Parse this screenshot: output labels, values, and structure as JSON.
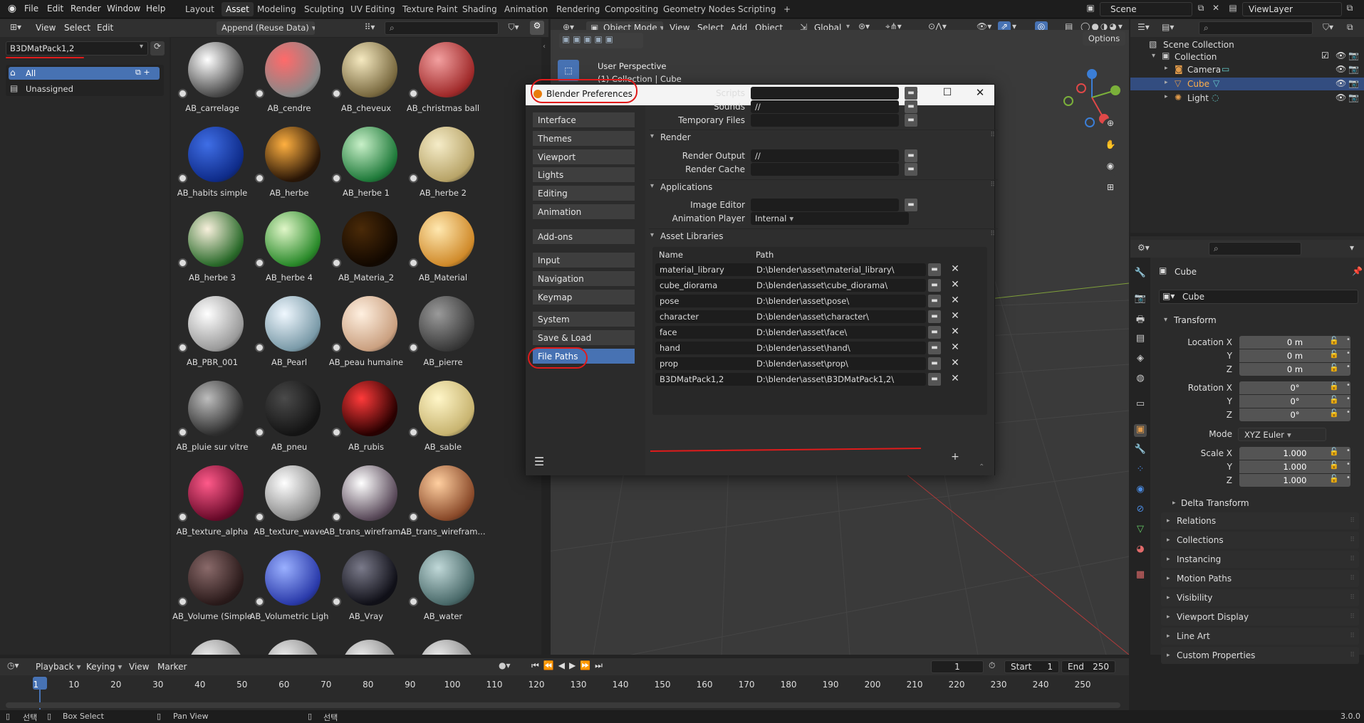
{
  "topbar": {
    "menus": [
      "File",
      "Edit",
      "Render",
      "Window",
      "Help"
    ],
    "workspaces": [
      "Layout",
      "Asset",
      "Modeling",
      "Sculpting",
      "UV Editing",
      "Texture Paint",
      "Shading",
      "Animation",
      "Rendering",
      "Compositing",
      "Geometry Nodes",
      "Scripting"
    ],
    "active_workspace": "Asset",
    "scene": "Scene",
    "viewlayer": "ViewLayer",
    "add_tab": "+"
  },
  "asset_browser": {
    "menus": [
      "View",
      "Select",
      "Edit"
    ],
    "import_method": "Append (Reuse Data)",
    "library": "B3DMatPack1,2",
    "catalogs": [
      "All",
      "Unassigned"
    ],
    "assets": [
      {
        "name": "AB_carrelage",
        "c1": "#ffffff",
        "c2": "#4a4a4a"
      },
      {
        "name": "AB_cendre",
        "c1": "#ff6a6a",
        "c2": "#888888"
      },
      {
        "name": "AB_cheveux",
        "c1": "#f5e9c0",
        "c2": "#7a6a40"
      },
      {
        "name": "AB_christmas ball",
        "c1": "#f2a0a0",
        "c2": "#a02a2a"
      },
      {
        "name": "AB_habits simple",
        "c1": "#3f6ee6",
        "c2": "#0f2c8a"
      },
      {
        "name": "AB_herbe",
        "c1": "#ffb040",
        "c2": "#2a1606"
      },
      {
        "name": "AB_herbe 1",
        "c1": "#c8f0c8",
        "c2": "#1f7a3a"
      },
      {
        "name": "AB_herbe 2",
        "c1": "#f5ecc8",
        "c2": "#b8a468"
      },
      {
        "name": "AB_herbe 3",
        "c1": "#f8f0dc",
        "c2": "#2a6a2a"
      },
      {
        "name": "AB_herbe 4",
        "c1": "#e0f6c8",
        "c2": "#2a8a2a"
      },
      {
        "name": "AB_Materia_2",
        "c1": "#4a2a08",
        "c2": "#120800"
      },
      {
        "name": "AB_Material",
        "c1": "#ffe8b0",
        "c2": "#d08a2a"
      },
      {
        "name": "AB_PBR_001",
        "c1": "#ffffff",
        "c2": "#9a9a9a"
      },
      {
        "name": "AB_Pearl",
        "c1": "#f0f8ff",
        "c2": "#7a9aa8"
      },
      {
        "name": "AB_peau humaine",
        "c1": "#fff0e0",
        "c2": "#caa080"
      },
      {
        "name": "AB_pierre",
        "c1": "#9a9a9a",
        "c2": "#3a3a3a"
      },
      {
        "name": "AB_pluie sur vitre",
        "c1": "#bdbdbd",
        "c2": "#2e2e2e"
      },
      {
        "name": "AB_pneu",
        "c1": "#4a4a4a",
        "c2": "#141414"
      },
      {
        "name": "AB_rubis",
        "c1": "#ff3a3a",
        "c2": "#2a0000"
      },
      {
        "name": "AB_sable",
        "c1": "#fff6c8",
        "c2": "#c8b470"
      },
      {
        "name": "AB_texture_alpha",
        "c1": "#ff5a8a",
        "c2": "#6a0a2a"
      },
      {
        "name": "AB_texture_wave",
        "c1": "#ffffff",
        "c2": "#8a8a8a"
      },
      {
        "name": "AB_trans_wirefram...",
        "c1": "#ffffff",
        "c2": "#5a4a5a"
      },
      {
        "name": "AB_trans_wirefram...",
        "c1": "#ffcfa0",
        "c2": "#8a4a2a"
      },
      {
        "name": "AB_Volume (Simple",
        "c1": "#8a6a6a",
        "c2": "#2a1a1a"
      },
      {
        "name": "AB_Volumetric Ligh",
        "c1": "#9ab0ff",
        "c2": "#2a3aaa"
      },
      {
        "name": "AB_Vray",
        "c1": "#7a7a8a",
        "c2": "#101018"
      },
      {
        "name": "AB_water",
        "c1": "#c0d8d8",
        "c2": "#4a6a6a"
      }
    ]
  },
  "viewport": {
    "mode": "Object Mode",
    "menus": [
      "View",
      "Select",
      "Add",
      "Object"
    ],
    "orientation": "Global",
    "options": "Options",
    "perspective": "User Perspective",
    "collection_line": "(1) Collection | Cube"
  },
  "prefs": {
    "title": "Blender Preferences",
    "nav_group1": [
      "Interface",
      "Themes",
      "Viewport",
      "Lights",
      "Editing",
      "Animation"
    ],
    "nav_group2": [
      "Add-ons"
    ],
    "nav_group3": [
      "Input",
      "Navigation",
      "Keymap"
    ],
    "nav_group4": [
      "System",
      "Save & Load",
      "File Paths"
    ],
    "active_nav": "File Paths",
    "rows_top": [
      {
        "label": "Scripts",
        "value": ""
      },
      {
        "label": "Sounds",
        "value": "//"
      },
      {
        "label": "Temporary Files",
        "value": ""
      }
    ],
    "render_title": "Render",
    "render_rows": [
      {
        "label": "Render Output",
        "value": "//"
      },
      {
        "label": "Render Cache",
        "value": ""
      }
    ],
    "apps_title": "Applications",
    "image_editor_label": "Image Editor",
    "image_editor_value": "",
    "anim_player_label": "Animation Player",
    "anim_player_value": "Internal",
    "libs_title": "Asset Libraries",
    "col_name": "Name",
    "col_path": "Path",
    "libraries": [
      {
        "name": "material_library",
        "path": "D:\\blender\\asset\\material_library\\"
      },
      {
        "name": "cube_diorama",
        "path": "D:\\blender\\asset\\cube_diorama\\"
      },
      {
        "name": "pose",
        "path": "D:\\blender\\asset\\pose\\"
      },
      {
        "name": "character",
        "path": "D:\\blender\\asset\\character\\"
      },
      {
        "name": "face",
        "path": "D:\\blender\\asset\\face\\"
      },
      {
        "name": "hand",
        "path": "D:\\blender\\asset\\hand\\"
      },
      {
        "name": "prop",
        "path": "D:\\blender\\asset\\prop\\"
      },
      {
        "name": "B3DMatPack1,2",
        "path": "D:\\blender\\asset\\B3DMatPack1,2\\"
      }
    ],
    "add_lib": "+"
  },
  "outliner": {
    "root": "Scene Collection",
    "collection": "Collection",
    "items": [
      "Camera",
      "Cube",
      "Light"
    ]
  },
  "properties": {
    "object_name": "Cube",
    "datablock": "Cube",
    "transform": "Transform",
    "loc_label": "Location X",
    "rot_label": "Rotation X",
    "scale_label": "Scale X",
    "y": "Y",
    "z": "Z",
    "loc": [
      "0 m",
      "0 m",
      "0 m"
    ],
    "rot": [
      "0°",
      "0°",
      "0°"
    ],
    "scale": [
      "1.000",
      "1.000",
      "1.000"
    ],
    "mode_label": "Mode",
    "mode_value": "XYZ Euler",
    "delta": "Delta Transform",
    "sections": [
      "Relations",
      "Collections",
      "Instancing",
      "Motion Paths",
      "Visibility",
      "Viewport Display",
      "Line Art",
      "Custom Properties"
    ]
  },
  "timeline": {
    "menus": [
      "Playback",
      "Keying",
      "View",
      "Marker"
    ],
    "current": "1",
    "start_label": "Start",
    "start": "1",
    "end_label": "End",
    "end": "250",
    "ticks": [
      "1",
      "10",
      "20",
      "30",
      "40",
      "50",
      "60",
      "70",
      "80",
      "90",
      "100",
      "110",
      "120",
      "130",
      "140",
      "150",
      "160",
      "170",
      "180",
      "190",
      "200",
      "210",
      "220",
      "230",
      "240",
      "250"
    ]
  },
  "status": {
    "left": "선택",
    "box": "Box Select",
    "pan": "Pan View",
    "right": "선택",
    "version": "3.0.0"
  },
  "accent": "#4772b3",
  "annotation": "#e01b1b"
}
